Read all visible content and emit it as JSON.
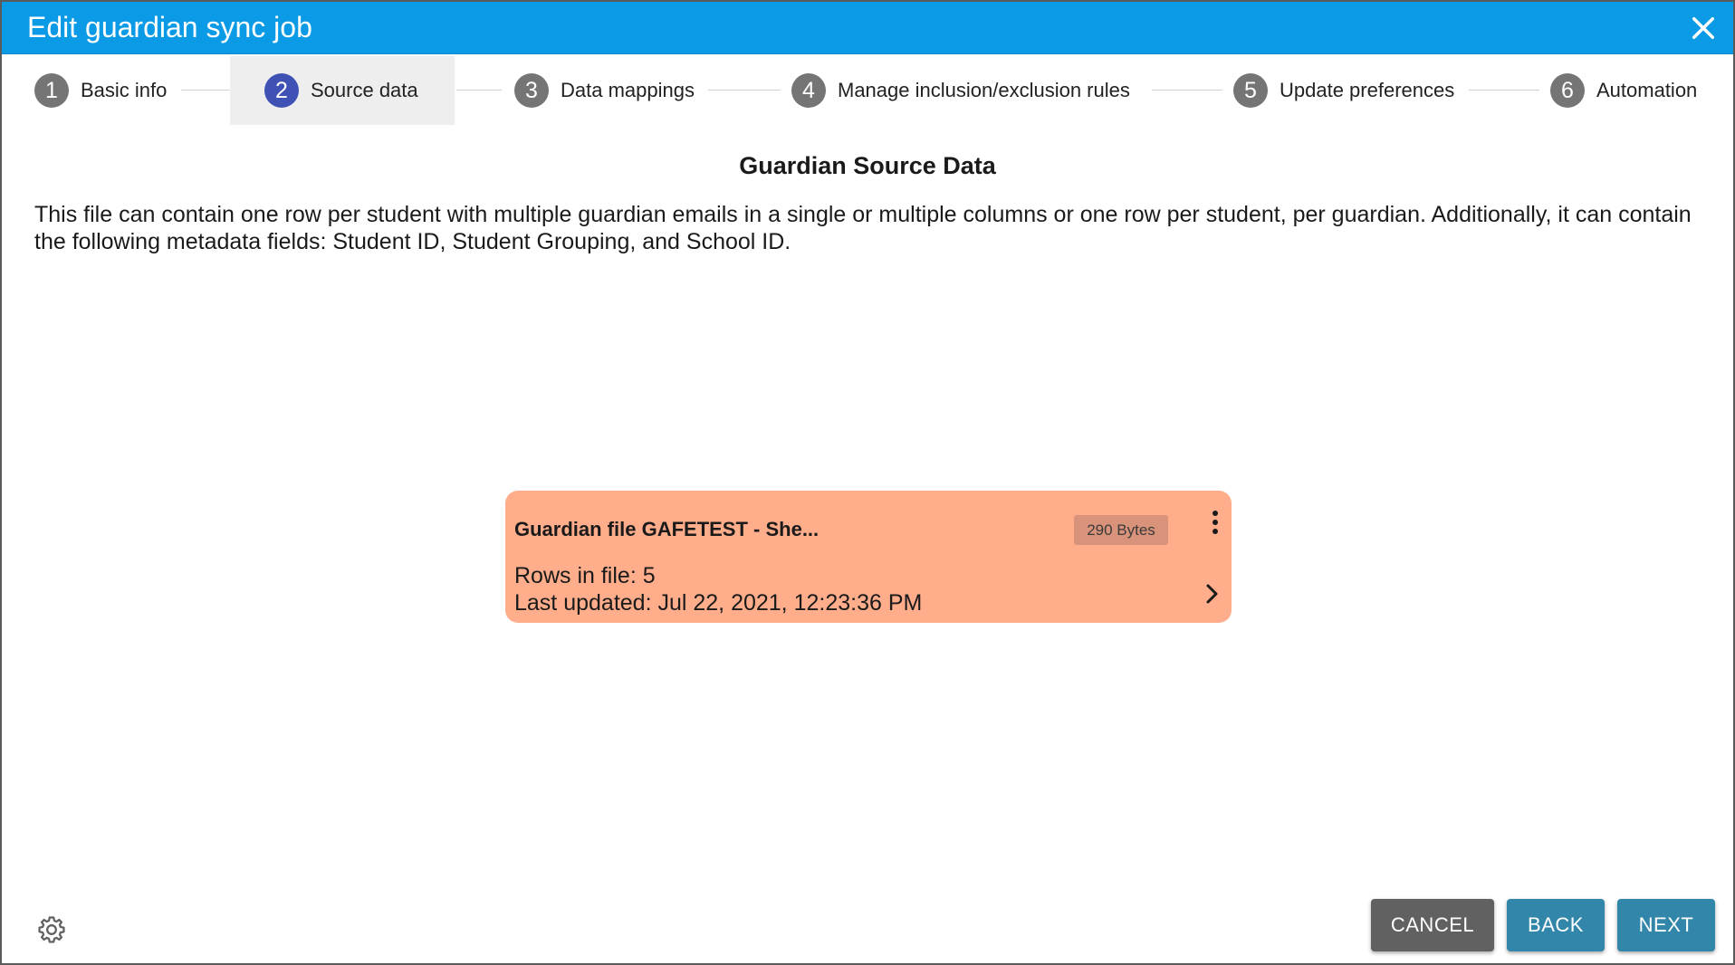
{
  "dialog": {
    "title": "Edit guardian sync job"
  },
  "stepper": {
    "steps": [
      {
        "number": "1",
        "label": "Basic info",
        "active": false
      },
      {
        "number": "2",
        "label": "Source data",
        "active": true
      },
      {
        "number": "3",
        "label": "Data mappings",
        "active": false
      },
      {
        "number": "4",
        "label": "Manage inclusion/exclusion rules",
        "active": false
      },
      {
        "number": "5",
        "label": "Update preferences",
        "active": false
      },
      {
        "number": "6",
        "label": "Automation",
        "active": false
      }
    ]
  },
  "main": {
    "section_title": "Guardian Source Data",
    "description": "This file can contain one row per student with multiple guardian emails in a single or multiple columns or one row per student, per guardian. Additionally, it can contain the following metadata fields: Student ID, Student Grouping, and School ID."
  },
  "file_card": {
    "name": "Guardian file GAFETEST - She...",
    "size": "290 Bytes",
    "rows": "Rows in file: 5",
    "last_updated": "Last updated: Jul 22, 2021, 12:23:36 PM",
    "menu_icon": "more-vert-icon",
    "chevron_icon": "chevron-right-icon",
    "card_color": "#ffad8b"
  },
  "footer": {
    "settings_icon": "gear-icon",
    "cancel_label": "CANCEL",
    "back_label": "BACK",
    "next_label": "NEXT"
  },
  "colors": {
    "titlebar": "#0a9ae6",
    "active_step": "#3f51b5",
    "inactive_step": "#757575",
    "primary_button": "#3286aa",
    "cancel_button": "#616161"
  }
}
